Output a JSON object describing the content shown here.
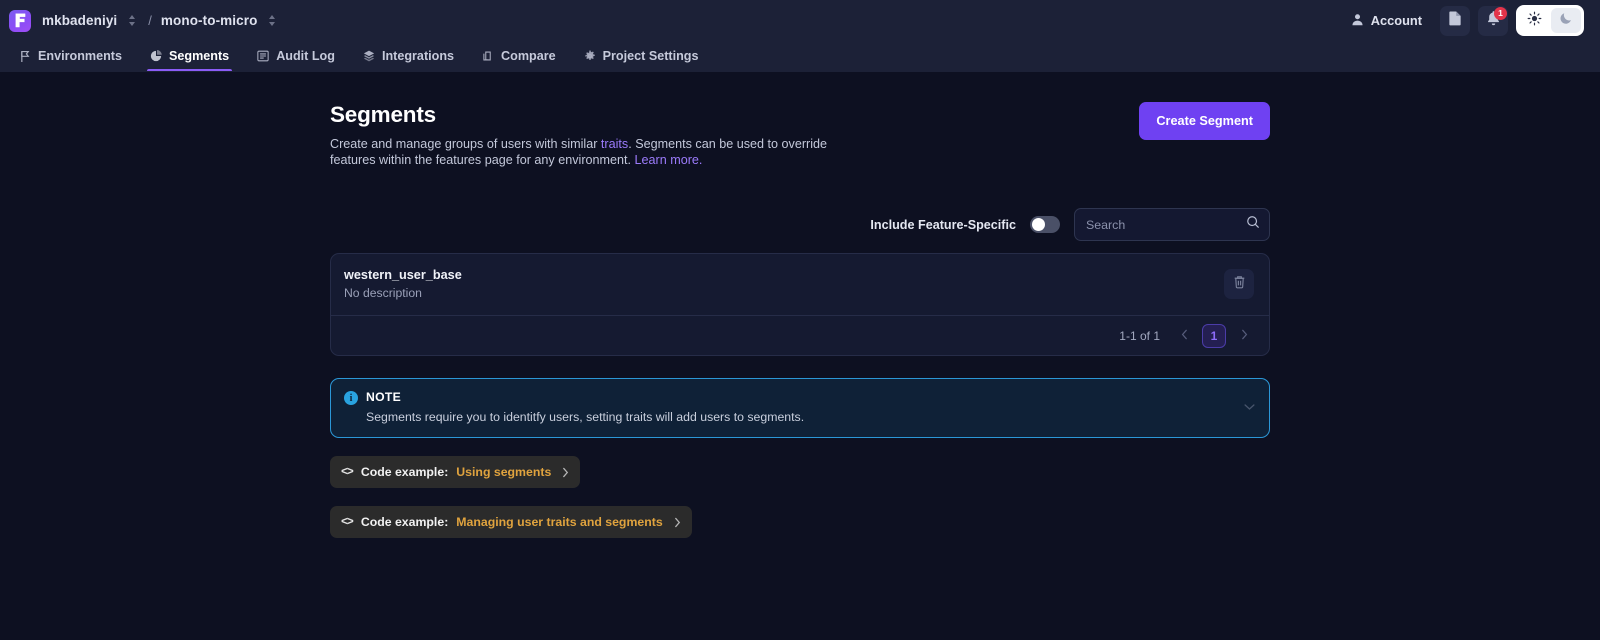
{
  "topbar": {
    "logo_icon": "flagsmith-logo-icon",
    "org_name": "mkbadeniyi",
    "separator": "/",
    "project_name": "mono-to-micro",
    "account_label": "Account",
    "account_icon": "user-icon",
    "docs_icon": "document-icon",
    "notifications_icon": "bell-icon",
    "notifications_count": "1",
    "theme_light_icon": "sun-icon",
    "theme_dark_icon": "moon-icon",
    "theme_selected": "light"
  },
  "nav": {
    "tabs": [
      {
        "label": "Environments",
        "icon": "flag-icon",
        "active": false
      },
      {
        "label": "Segments",
        "icon": "pie-chart-icon",
        "active": true
      },
      {
        "label": "Audit Log",
        "icon": "list-icon",
        "active": false
      },
      {
        "label": "Integrations",
        "icon": "layers-icon",
        "active": false
      },
      {
        "label": "Compare",
        "icon": "compare-icon",
        "active": false
      },
      {
        "label": "Project Settings",
        "icon": "gear-icon",
        "active": false
      }
    ]
  },
  "main": {
    "title": "Segments",
    "subtitle_part1": "Create and manage groups of users with similar ",
    "subtitle_link1": "traits",
    "subtitle_part2": ". Segments can be used to override features within the features page for any environment. ",
    "subtitle_link2": "Learn more.",
    "create_button": "Create Segment"
  },
  "filters": {
    "toggle_label": "Include Feature-Specific",
    "toggle_on": false,
    "search_placeholder": "Search",
    "search_value": "",
    "search_icon": "search-icon"
  },
  "segments": {
    "rows": [
      {
        "name": "western_user_base",
        "description": "No description",
        "delete_icon": "trash-icon"
      }
    ],
    "pagination": {
      "count_label": "1-1 of 1",
      "prev_icon": "chevron-left-icon",
      "next_icon": "chevron-right-icon",
      "pages": [
        "1"
      ],
      "current_page": "1"
    }
  },
  "note": {
    "icon": "info-icon",
    "title": "NOTE",
    "body": "Segments require you to identitfy users, setting traits will add users to segments.",
    "collapse_icon": "chevron-down-icon"
  },
  "code_examples": [
    {
      "glyph": "<>",
      "prefix": "Code example:",
      "accent": "Using segments",
      "chevron_icon": "chevron-right-icon"
    },
    {
      "glyph": "<>",
      "prefix": "Code example:",
      "accent": "Managing user traits and segments",
      "chevron_icon": "chevron-right-icon"
    }
  ],
  "colors": {
    "accent_purple": "#6f41f2",
    "link_purple": "#9b7bfb",
    "note_blue": "#2b97d6",
    "code_accent": "#e0a33e",
    "badge_red": "#e3344a",
    "page_bg": "#0d1021",
    "bar_bg": "#1c2137"
  }
}
